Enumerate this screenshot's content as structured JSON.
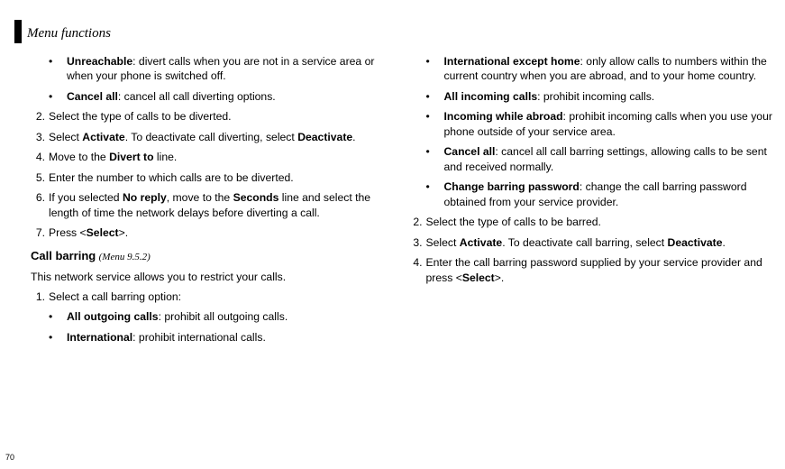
{
  "header": {
    "title": "Menu functions"
  },
  "pageNumber": "70",
  "left": {
    "bullets1": [
      {
        "term": "Unreachable",
        "desc": ": divert calls when you are not in a service area or when your phone is switched off."
      },
      {
        "term": "Cancel all",
        "desc": ": cancel all call diverting options."
      }
    ],
    "steps1": [
      {
        "n": "2.",
        "parts": [
          {
            "t": "Select the type of calls to be diverted."
          }
        ]
      },
      {
        "n": "3.",
        "parts": [
          {
            "t": "Select "
          },
          {
            "b": "Activate"
          },
          {
            "t": ". To deactivate call diverting, select "
          },
          {
            "b": "Deactivate"
          },
          {
            "t": "."
          }
        ]
      },
      {
        "n": "4.",
        "parts": [
          {
            "t": "Move to the "
          },
          {
            "b": "Divert to"
          },
          {
            "t": " line."
          }
        ]
      },
      {
        "n": "5.",
        "parts": [
          {
            "t": "Enter the number to which calls are to be diverted."
          }
        ]
      },
      {
        "n": "6.",
        "parts": [
          {
            "t": "If you selected "
          },
          {
            "b": "No reply"
          },
          {
            "t": ", move to the "
          },
          {
            "b": "Seconds"
          },
          {
            "t": " line and select the length of time the network delays before diverting a call."
          }
        ]
      },
      {
        "n": "7.",
        "parts": [
          {
            "t": "Press <"
          },
          {
            "b": "Select"
          },
          {
            "t": ">."
          }
        ]
      }
    ],
    "section": {
      "title": "Call barring",
      "menu": "(Menu 9.5.2)"
    },
    "intro": "This network service allows you to restrict your calls.",
    "steps2": [
      {
        "n": "1.",
        "parts": [
          {
            "t": "Select a call barring option:"
          }
        ]
      }
    ],
    "bullets2": [
      {
        "term": "All outgoing calls",
        "desc": ": prohibit all outgoing calls."
      },
      {
        "term": "International",
        "desc": ": prohibit international calls."
      }
    ]
  },
  "right": {
    "bullets": [
      {
        "term": "International except home",
        "desc": ": only allow calls to numbers within the current country when you are abroad, and to your home country."
      },
      {
        "term": "All incoming calls",
        "desc": ": prohibit incoming calls."
      },
      {
        "term": "Incoming while abroad",
        "desc": ": prohibit incoming calls when you use your phone outside of your service area."
      },
      {
        "term": "Cancel all",
        "desc": ": cancel all call barring settings, allowing calls to be sent and received normally."
      },
      {
        "term": "Change barring password",
        "desc": ": change the call barring password obtained from your service provider."
      }
    ],
    "steps": [
      {
        "n": "2.",
        "parts": [
          {
            "t": "Select the type of calls to be barred."
          }
        ]
      },
      {
        "n": "3.",
        "parts": [
          {
            "t": "Select "
          },
          {
            "b": "Activate"
          },
          {
            "t": ". To deactivate call barring, select "
          },
          {
            "b": "Deactivate"
          },
          {
            "t": "."
          }
        ]
      },
      {
        "n": "4.",
        "parts": [
          {
            "t": "Enter the call barring password supplied by your service provider and press <"
          },
          {
            "b": "Select"
          },
          {
            "t": ">."
          }
        ]
      }
    ]
  }
}
